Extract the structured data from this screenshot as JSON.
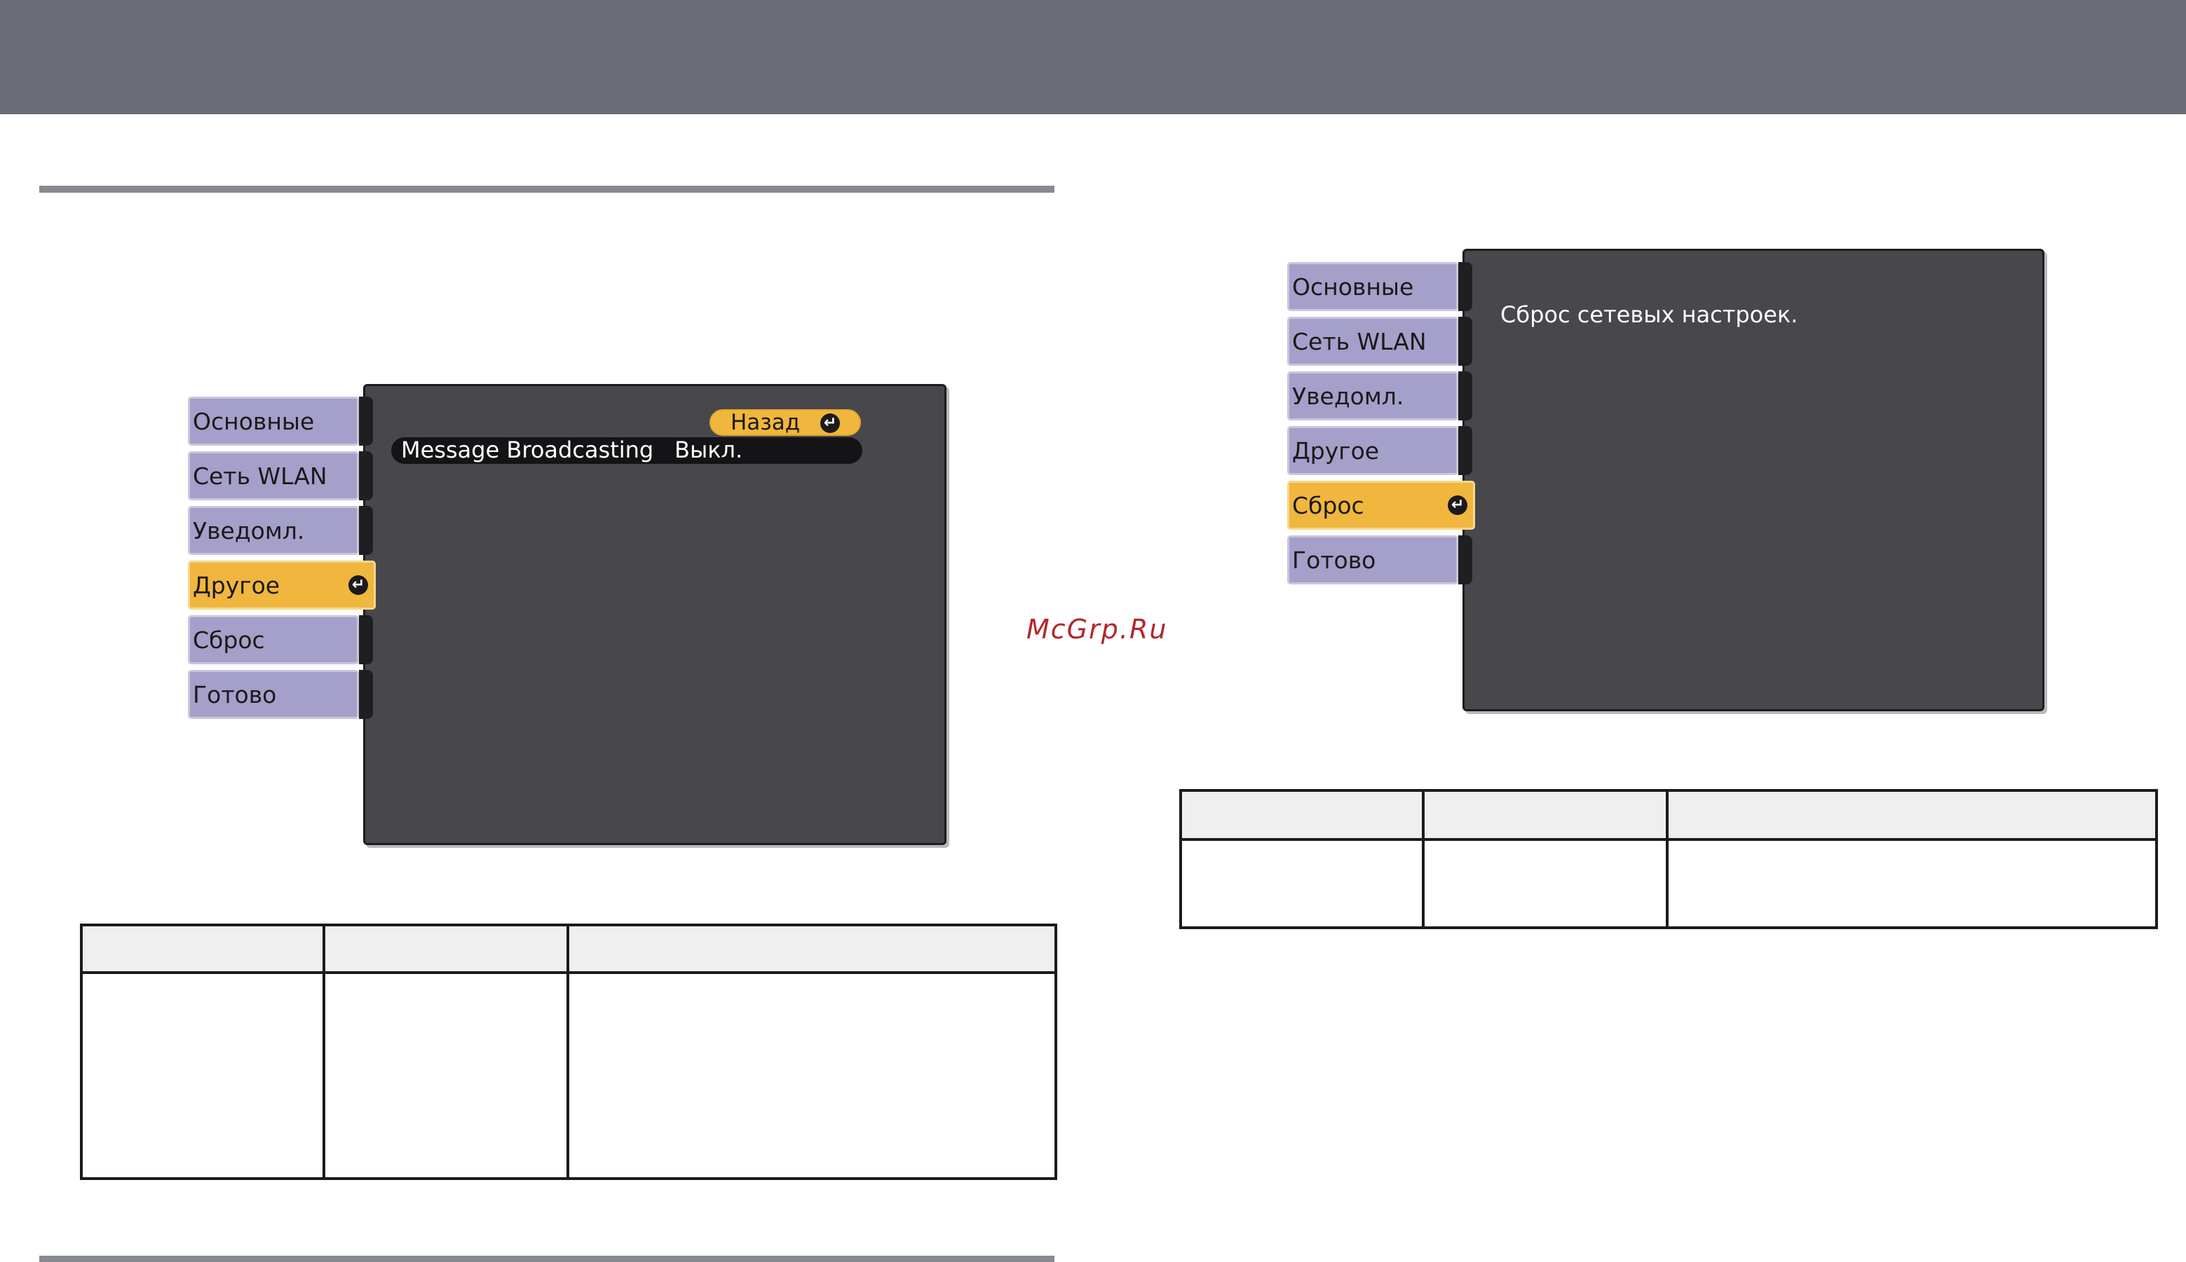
{
  "watermark": "McGrp.Ru",
  "left_screen": {
    "tabs": [
      {
        "label": "Основные",
        "active": false
      },
      {
        "label": "Сеть WLAN",
        "active": false
      },
      {
        "label": "Уведомл.",
        "active": false
      },
      {
        "label": "Другое",
        "active": true
      },
      {
        "label": "Сброс",
        "active": false
      },
      {
        "label": "Готово",
        "active": false
      }
    ],
    "back_button": "Назад",
    "setting_name": "Message Broadcasting",
    "setting_value": "Выкл."
  },
  "right_screen": {
    "tabs": [
      {
        "label": "Основные",
        "active": false
      },
      {
        "label": "Сеть WLAN",
        "active": false
      },
      {
        "label": "Уведомл.",
        "active": false
      },
      {
        "label": "Другое",
        "active": false
      },
      {
        "label": "Сброс",
        "active": true
      },
      {
        "label": "Готово",
        "active": false
      }
    ],
    "message": "Сброс сетевых настроек."
  },
  "colors": {
    "tab_inactive": "#a5a0c9",
    "tab_active": "#f0b63e",
    "panel": "#48484c",
    "header_band": "#696b75",
    "watermark": "#b3262c"
  },
  "icons": {
    "enter": "enter-icon"
  }
}
